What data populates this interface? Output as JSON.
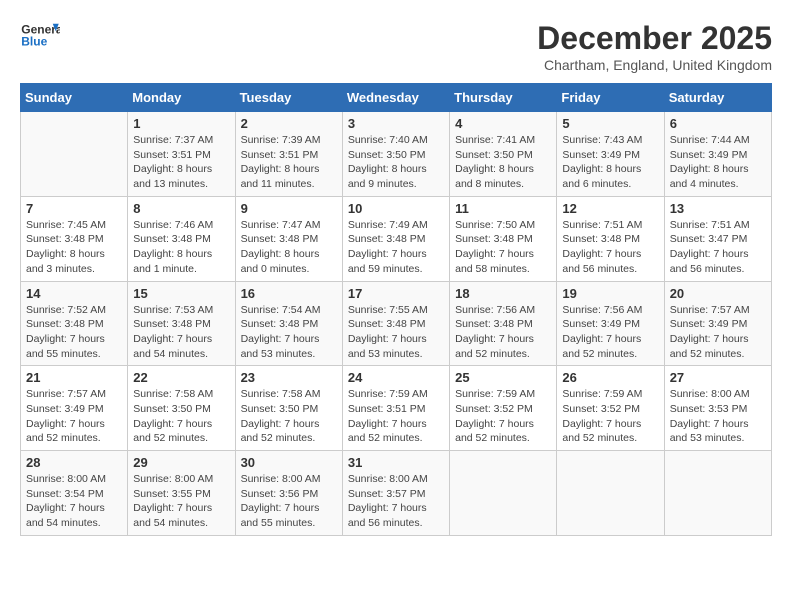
{
  "logo": {
    "general": "General",
    "blue": "Blue"
  },
  "title": "December 2025",
  "location": "Chartham, England, United Kingdom",
  "days_of_week": [
    "Sunday",
    "Monday",
    "Tuesday",
    "Wednesday",
    "Thursday",
    "Friday",
    "Saturday"
  ],
  "weeks": [
    [
      {
        "num": "",
        "sunrise": "",
        "sunset": "",
        "daylight": ""
      },
      {
        "num": "1",
        "sunrise": "7:37 AM",
        "sunset": "3:51 PM",
        "daylight": "8 hours and 13 minutes."
      },
      {
        "num": "2",
        "sunrise": "7:39 AM",
        "sunset": "3:51 PM",
        "daylight": "8 hours and 11 minutes."
      },
      {
        "num": "3",
        "sunrise": "7:40 AM",
        "sunset": "3:50 PM",
        "daylight": "8 hours and 9 minutes."
      },
      {
        "num": "4",
        "sunrise": "7:41 AM",
        "sunset": "3:50 PM",
        "daylight": "8 hours and 8 minutes."
      },
      {
        "num": "5",
        "sunrise": "7:43 AM",
        "sunset": "3:49 PM",
        "daylight": "8 hours and 6 minutes."
      },
      {
        "num": "6",
        "sunrise": "7:44 AM",
        "sunset": "3:49 PM",
        "daylight": "8 hours and 4 minutes."
      }
    ],
    [
      {
        "num": "7",
        "sunrise": "7:45 AM",
        "sunset": "3:48 PM",
        "daylight": "8 hours and 3 minutes."
      },
      {
        "num": "8",
        "sunrise": "7:46 AM",
        "sunset": "3:48 PM",
        "daylight": "8 hours and 1 minute."
      },
      {
        "num": "9",
        "sunrise": "7:47 AM",
        "sunset": "3:48 PM",
        "daylight": "8 hours and 0 minutes."
      },
      {
        "num": "10",
        "sunrise": "7:49 AM",
        "sunset": "3:48 PM",
        "daylight": "7 hours and 59 minutes."
      },
      {
        "num": "11",
        "sunrise": "7:50 AM",
        "sunset": "3:48 PM",
        "daylight": "7 hours and 58 minutes."
      },
      {
        "num": "12",
        "sunrise": "7:51 AM",
        "sunset": "3:48 PM",
        "daylight": "7 hours and 56 minutes."
      },
      {
        "num": "13",
        "sunrise": "7:51 AM",
        "sunset": "3:47 PM",
        "daylight": "7 hours and 56 minutes."
      }
    ],
    [
      {
        "num": "14",
        "sunrise": "7:52 AM",
        "sunset": "3:48 PM",
        "daylight": "7 hours and 55 minutes."
      },
      {
        "num": "15",
        "sunrise": "7:53 AM",
        "sunset": "3:48 PM",
        "daylight": "7 hours and 54 minutes."
      },
      {
        "num": "16",
        "sunrise": "7:54 AM",
        "sunset": "3:48 PM",
        "daylight": "7 hours and 53 minutes."
      },
      {
        "num": "17",
        "sunrise": "7:55 AM",
        "sunset": "3:48 PM",
        "daylight": "7 hours and 53 minutes."
      },
      {
        "num": "18",
        "sunrise": "7:56 AM",
        "sunset": "3:48 PM",
        "daylight": "7 hours and 52 minutes."
      },
      {
        "num": "19",
        "sunrise": "7:56 AM",
        "sunset": "3:49 PM",
        "daylight": "7 hours and 52 minutes."
      },
      {
        "num": "20",
        "sunrise": "7:57 AM",
        "sunset": "3:49 PM",
        "daylight": "7 hours and 52 minutes."
      }
    ],
    [
      {
        "num": "21",
        "sunrise": "7:57 AM",
        "sunset": "3:49 PM",
        "daylight": "7 hours and 52 minutes."
      },
      {
        "num": "22",
        "sunrise": "7:58 AM",
        "sunset": "3:50 PM",
        "daylight": "7 hours and 52 minutes."
      },
      {
        "num": "23",
        "sunrise": "7:58 AM",
        "sunset": "3:50 PM",
        "daylight": "7 hours and 52 minutes."
      },
      {
        "num": "24",
        "sunrise": "7:59 AM",
        "sunset": "3:51 PM",
        "daylight": "7 hours and 52 minutes."
      },
      {
        "num": "25",
        "sunrise": "7:59 AM",
        "sunset": "3:52 PM",
        "daylight": "7 hours and 52 minutes."
      },
      {
        "num": "26",
        "sunrise": "7:59 AM",
        "sunset": "3:52 PM",
        "daylight": "7 hours and 52 minutes."
      },
      {
        "num": "27",
        "sunrise": "8:00 AM",
        "sunset": "3:53 PM",
        "daylight": "7 hours and 53 minutes."
      }
    ],
    [
      {
        "num": "28",
        "sunrise": "8:00 AM",
        "sunset": "3:54 PM",
        "daylight": "7 hours and 54 minutes."
      },
      {
        "num": "29",
        "sunrise": "8:00 AM",
        "sunset": "3:55 PM",
        "daylight": "7 hours and 54 minutes."
      },
      {
        "num": "30",
        "sunrise": "8:00 AM",
        "sunset": "3:56 PM",
        "daylight": "7 hours and 55 minutes."
      },
      {
        "num": "31",
        "sunrise": "8:00 AM",
        "sunset": "3:57 PM",
        "daylight": "7 hours and 56 minutes."
      },
      {
        "num": "",
        "sunrise": "",
        "sunset": "",
        "daylight": ""
      },
      {
        "num": "",
        "sunrise": "",
        "sunset": "",
        "daylight": ""
      },
      {
        "num": "",
        "sunrise": "",
        "sunset": "",
        "daylight": ""
      }
    ]
  ]
}
